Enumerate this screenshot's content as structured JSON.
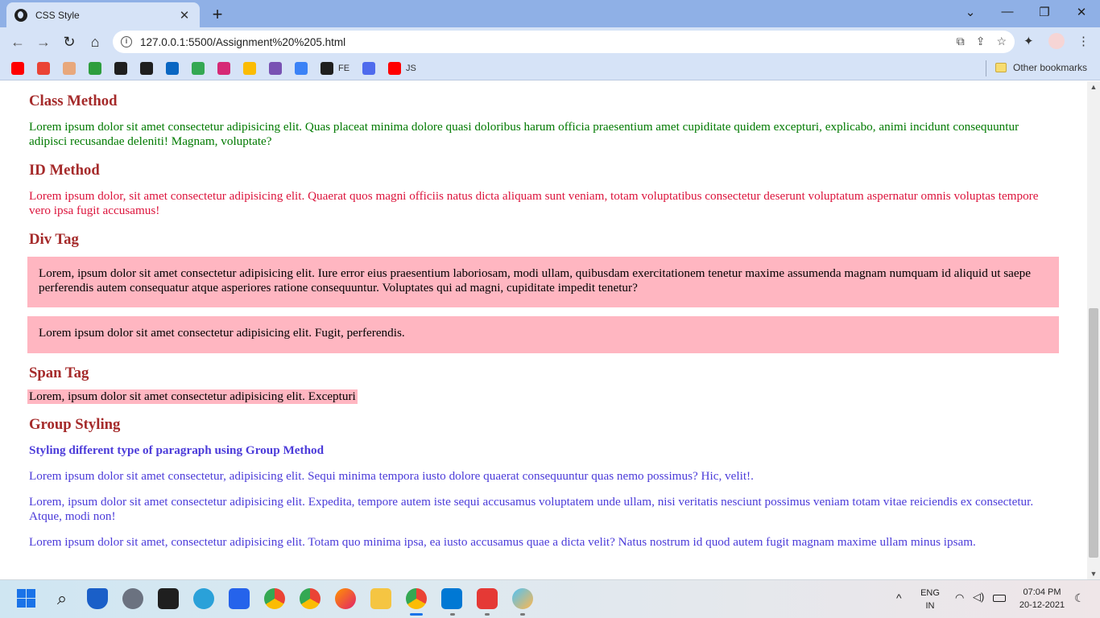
{
  "browser": {
    "tab_title": "CSS Style",
    "tab_close": "✕",
    "new_tab": "+",
    "url": "127.0.0.1:5500/Assignment%20%205.html",
    "window_controls": {
      "dropdown": "⌄",
      "minimize": "—",
      "restore": "❐",
      "close": "✕"
    },
    "nav": {
      "back": "←",
      "forward": "→",
      "reload": "↻",
      "home": "⌂"
    },
    "bookmarks": [
      {
        "icon": "youtube-icon",
        "label": "",
        "color": "#ff0000"
      },
      {
        "icon": "gmail-icon",
        "label": "",
        "color": "#ea4335"
      },
      {
        "icon": "profile-icon",
        "label": "",
        "color": "#e8a87c"
      },
      {
        "icon": "w-icon",
        "label": "",
        "color": "#2e9e3e"
      },
      {
        "icon": "globe-icon",
        "label": "",
        "color": "#1f1f1f"
      },
      {
        "icon": "github-icon",
        "label": "",
        "color": "#1f1f1f"
      },
      {
        "icon": "linkedin-icon",
        "label": "",
        "color": "#0a66c2"
      },
      {
        "icon": "drive-icon",
        "label": "",
        "color": "#34a853"
      },
      {
        "icon": "instagram-icon",
        "label": "",
        "color": "#d62976"
      },
      {
        "icon": "keep-icon",
        "label": "",
        "color": "#fbbc04"
      },
      {
        "icon": "bootstrap-icon",
        "label": "",
        "color": "#7952b3"
      },
      {
        "icon": "two-icon",
        "label": "",
        "color": "#3b82f6"
      },
      {
        "icon": "github-fe-icon",
        "label": "FE",
        "color": "#1f1f1f"
      },
      {
        "icon": "c-icon",
        "label": "",
        "color": "#4f6bed"
      },
      {
        "icon": "youtube-js-icon",
        "label": "JS",
        "color": "#ff0000"
      }
    ],
    "other_bookmarks": "Other bookmarks"
  },
  "page": {
    "class_method": {
      "heading": "Class Method",
      "text": "Lorem ipsum dolor sit amet consectetur adipisicing elit. Quas placeat minima dolore quasi doloribus harum officia praesentium amet cupiditate quidem excepturi, explicabo, animi incidunt consequuntur adipisci recusandae deleniti! Magnam, voluptate?"
    },
    "id_method": {
      "heading": "ID Method",
      "text": "Lorem ipsum dolor, sit amet consectetur adipisicing elit. Quaerat quos magni officiis natus dicta aliquam sunt veniam, totam voluptatibus consectetur deserunt voluptatum aspernatur omnis voluptas tempore vero ipsa fugit accusamus!"
    },
    "div_tag": {
      "heading": "Div Tag",
      "box1": "Lorem, ipsum dolor sit amet consectetur adipisicing elit. Iure error eius praesentium laboriosam, modi ullam, quibusdam exercitationem tenetur maxime assumenda magnam numquam id aliquid ut saepe perferendis autem consequatur atque asperiores ratione consequuntur. Voluptates qui ad magni, cupiditate impedit tenetur?",
      "box2": "Lorem ipsum dolor sit amet consectetur adipisicing elit. Fugit, perferendis."
    },
    "span_tag": {
      "heading": "Span Tag",
      "text": "Lorem, ipsum dolor sit amet consectetur adipisicing elit. Excepturi"
    },
    "group_styling": {
      "heading": "Group Styling",
      "subheading": "Styling different type of paragraph using Group Method",
      "p1": "Lorem ipsum dolor sit amet consectetur, adipisicing elit. Sequi minima tempora iusto dolore quaerat consequuntur quas nemo possimus? Hic, velit!.",
      "p2": "Lorem, ipsum dolor sit amet consectetur adipisicing elit. Expedita, tempore autem iste sequi accusamus voluptatem unde ullam, nisi veritatis nesciunt possimus veniam totam vitae reiciendis ex consectetur. Atque, modi non!",
      "p3": "Lorem ipsum dolor sit amet, consectetur adipisicing elit. Totam quo minima ipsa, ea iusto accusamus quae a dicta velit? Natus nostrum id quod autem fugit magnam maxime ullam minus ipsam."
    }
  },
  "taskbar": {
    "language": "ENG",
    "region": "IN",
    "time": "07:04 PM",
    "date": "20-12-2021"
  },
  "colors": {
    "heading": "#a52a2a",
    "class_text": "#007a00",
    "id_text": "#dc143c",
    "pink_bg": "#ffb6c1",
    "group_text": "#4b3bd9"
  }
}
